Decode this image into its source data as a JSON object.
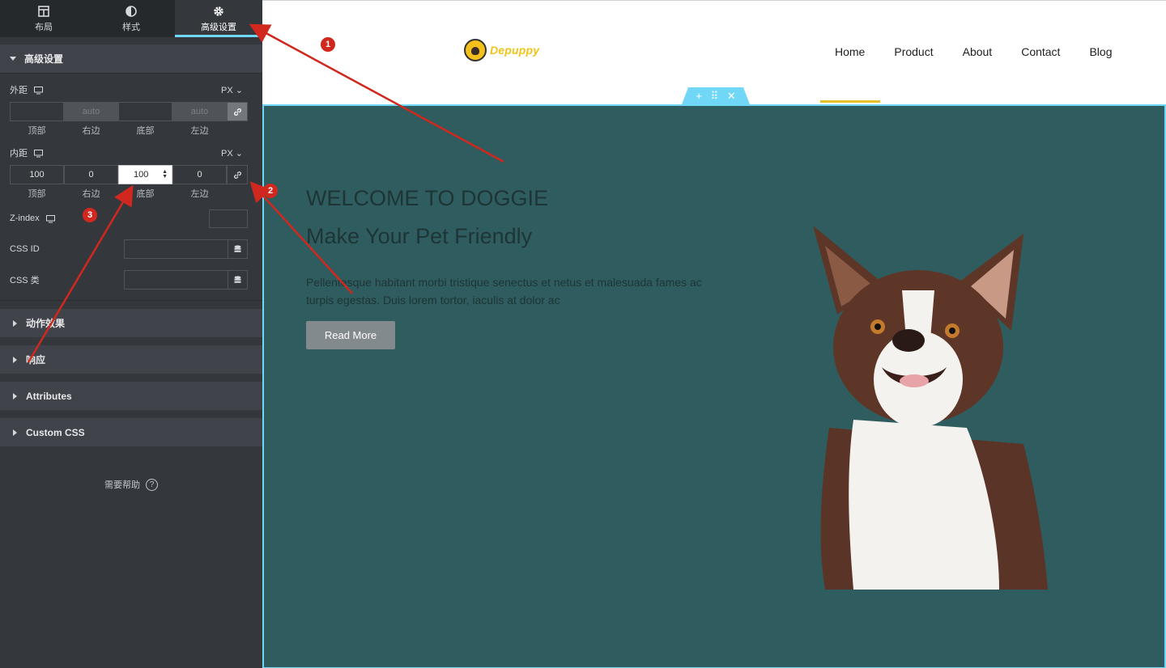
{
  "tabs": [
    {
      "label": "布局",
      "icon": "layout-icon"
    },
    {
      "label": "样式",
      "icon": "contrast-icon"
    },
    {
      "label": "高级设置",
      "icon": "gear-icon"
    }
  ],
  "advanced": {
    "title": "高级设置",
    "margin": {
      "label": "外距",
      "unit": "PX",
      "values": [
        "",
        "auto",
        "",
        "auto"
      ],
      "sides": [
        "顶部",
        "右边",
        "底部",
        "左边"
      ]
    },
    "padding": {
      "label": "内距",
      "unit": "PX",
      "values": [
        "100",
        "0",
        "100",
        "0"
      ],
      "sides": [
        "顶部",
        "右边",
        "底部",
        "左边"
      ]
    },
    "zindex_label": "Z-index",
    "css_id_label": "CSS ID",
    "css_class_label": "CSS 类"
  },
  "collapsed_sections": [
    "动作效果",
    "响应",
    "Attributes",
    "Custom CSS"
  ],
  "help_label": "需要帮助",
  "site": {
    "logo_text": "Depuppy",
    "nav": [
      "Home",
      "Product",
      "About",
      "Contact",
      "Blog"
    ],
    "hero_title": "WELCOME TO DOGGIE",
    "hero_subtitle": "Make Your Pet Friendly",
    "hero_paragraph": "Pellentesque habitant morbi tristique senectus et netus et malesuada fames ac turpis egestas. Duis lorem tortor, iaculis at dolor ac",
    "hero_button": "Read More"
  },
  "annotations": [
    "1",
    "2",
    "3"
  ],
  "colors": {
    "accent": "#71d7f7",
    "hero_bg": "#2f5c5e",
    "badge": "#d0281e",
    "nav_underline": "#e8c02c"
  }
}
